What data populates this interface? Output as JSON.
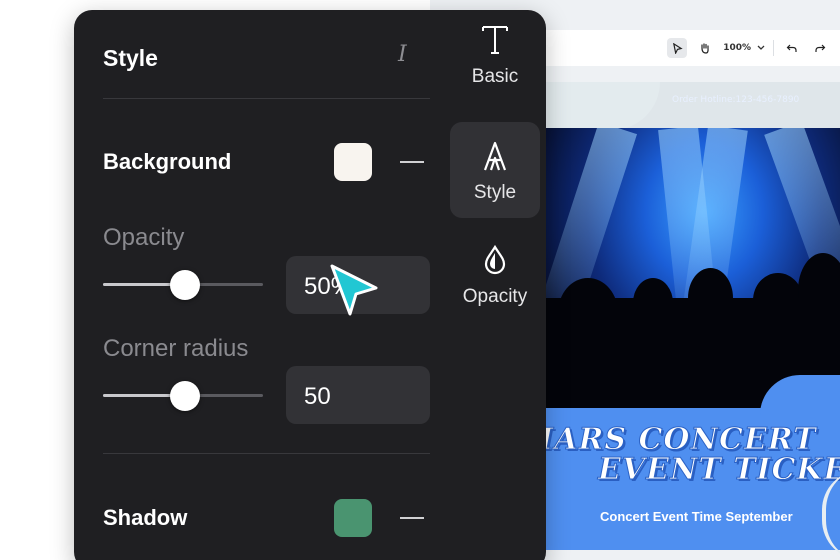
{
  "toolbar": {
    "zoom": "100%",
    "tools": [
      "pointer-icon",
      "hand-icon",
      "undo-icon",
      "redo-icon"
    ]
  },
  "poster": {
    "hotline": "Order Hotline:123-456-7890",
    "title_line1": "MARS CONCERT",
    "title_line2": "EVENT TICKET",
    "subtitle": "Concert Event Time September",
    "colors": {
      "accent": "#4f8ff0"
    }
  },
  "panel": {
    "title": "Style",
    "title_icon": "italic-icon",
    "background": {
      "label": "Background",
      "color": "#f8f4ef"
    },
    "opacity": {
      "label": "Opacity",
      "value": "50%",
      "fraction": 0.5
    },
    "corner_radius": {
      "label": "Corner radius",
      "value": "50",
      "fraction": 0.5
    },
    "shadow": {
      "label": "Shadow",
      "color": "#4a9470"
    }
  },
  "rail": {
    "items": [
      {
        "label": "Basic",
        "icon": "text-icon"
      },
      {
        "label": "Style",
        "icon": "style-icon",
        "active": true
      },
      {
        "label": "Opacity",
        "icon": "drop-icon"
      }
    ]
  }
}
